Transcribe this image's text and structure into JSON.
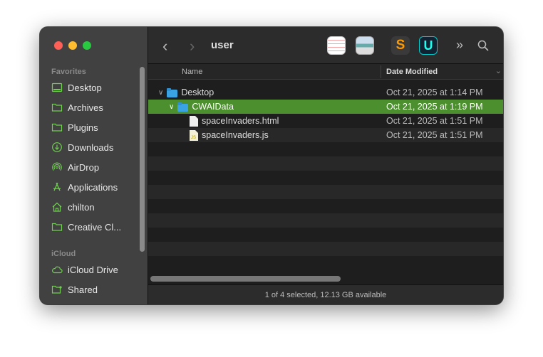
{
  "window": {
    "title": "user"
  },
  "sidebar": {
    "sections": [
      {
        "label": "Favorites"
      },
      {
        "label": "iCloud"
      }
    ],
    "favorites": [
      {
        "label": "Desktop",
        "icon": "desktop-icon"
      },
      {
        "label": "Archives",
        "icon": "folder-icon"
      },
      {
        "label": "Plugins",
        "icon": "folder-icon"
      },
      {
        "label": "Downloads",
        "icon": "download-icon"
      },
      {
        "label": "AirDrop",
        "icon": "airdrop-icon"
      },
      {
        "label": "Applications",
        "icon": "applications-icon"
      },
      {
        "label": "chilton",
        "icon": "home-icon"
      },
      {
        "label": "Creative Cl...",
        "icon": "folder-icon"
      }
    ],
    "icloud": [
      {
        "label": "iCloud Drive",
        "icon": "cloud-icon"
      },
      {
        "label": "Shared",
        "icon": "shared-folder-icon"
      }
    ]
  },
  "columns": {
    "name": "Name",
    "date": "Date Modified"
  },
  "files": [
    {
      "name": "Desktop",
      "date": "Oct 21, 2025 at 1:14 PM"
    },
    {
      "name": "CWAIData",
      "date": "Oct 21, 2025 at 1:19 PM"
    },
    {
      "name": "spaceInvaders.html",
      "date": "Oct 21, 2025 at 1:51 PM"
    },
    {
      "name": "spaceInvaders.js",
      "date": "Oct 21, 2025 at 1:51 PM"
    }
  ],
  "status": "1 of 4 selected, 12.13 GB available",
  "colors": {
    "accent": "#4c8f2e",
    "sidebar_icon": "#6fcf4f"
  }
}
